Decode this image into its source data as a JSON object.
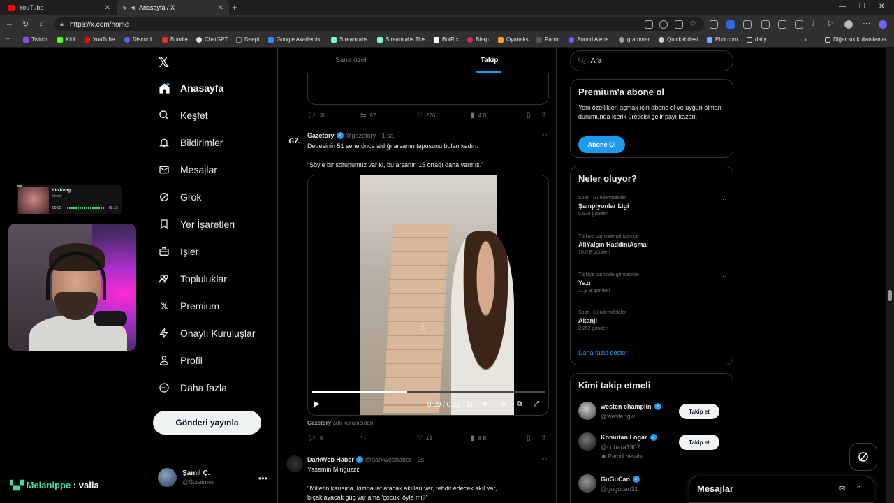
{
  "browser": {
    "tabs": [
      {
        "title": "YouTube",
        "color": "#ff0000"
      },
      {
        "title": "Anasayfa / X",
        "color": "#ffffff"
      }
    ],
    "url": "https://x.com/home",
    "bookmarks": [
      "Twitch",
      "Kick",
      "YouTube",
      "Discord",
      "Bundle",
      "ChatGPT",
      "DeepL",
      "Google Akademik",
      "Streamlabs",
      "Streamlabs Tips",
      "BotRix",
      "Blerp",
      "Oyuneks",
      "Parrot",
      "Sound Alerts",
      "grammer",
      "Quickabdest",
      "Pixlr.com",
      "daily"
    ],
    "bookmarks_other": "Diğer sık kullanılanlar"
  },
  "nav": {
    "items": [
      {
        "label": "Anasayfa",
        "icon": "home-icon"
      },
      {
        "label": "Keşfet",
        "icon": "search-icon"
      },
      {
        "label": "Bildirimler",
        "icon": "bell-icon"
      },
      {
        "label": "Mesajlar",
        "icon": "mail-icon"
      },
      {
        "label": "Grok",
        "icon": "grok-icon"
      },
      {
        "label": "Yer İşaretleri",
        "icon": "bookmark-icon"
      },
      {
        "label": "İşler",
        "icon": "briefcase-icon"
      },
      {
        "label": "Topluluklar",
        "icon": "people-icon"
      },
      {
        "label": "Premium",
        "icon": "x-icon"
      },
      {
        "label": "Onaylı Kuruluşlar",
        "icon": "bolt-icon"
      },
      {
        "label": "Profil",
        "icon": "person-icon"
      },
      {
        "label": "Daha fazla",
        "icon": "more-circle-icon"
      }
    ],
    "post_button": "Gönderi yayınla",
    "user": {
      "name": "Şamil Ç.",
      "handle": "@Scraimm"
    }
  },
  "overlay": {
    "music": {
      "title": "Liu Kong",
      "subtitle": "!moriy",
      "time_start": "00:05",
      "time_end": "02:19"
    },
    "chat": {
      "user": "Melanippe",
      "separator": " : ",
      "message": "valla"
    }
  },
  "timeline": {
    "tabs": [
      "Sana özel",
      "Takip"
    ],
    "prev_actions": {
      "replies": "38",
      "reposts": "97",
      "likes": "276",
      "views": "4 B"
    },
    "tweet1": {
      "avatar_text": "GZ.",
      "name": "Gazetory",
      "handle": "@gazetory",
      "time": "· 1 sa",
      "line1": "Dedesinin 51 sene önce aldığı arsanın tapusunu bulan kadın:",
      "line2": "“Şöyle bir sorunumuz var ki, bu arsanın 15 ortağı daha varmış.”",
      "video_time": "0:09 / 0:22",
      "video_progress": 0.41,
      "via_name": "Gazetory",
      "via_text": "adlı kullanıcıdan",
      "replies": "9",
      "reposts": "",
      "likes": "19",
      "views": "8 B"
    },
    "tweet2": {
      "name": "DarkWeb Haber",
      "handle": "@darkwebhaber",
      "time": "· 2s",
      "line1": "Yasemin Minguzzi:",
      "line2": "\"Milletin karısına, kızına laf atacak akılları var, tehdit edecek akıl var,",
      "line3": "bıçaklayacak güç var ama 'çocuk' öyle mi?\""
    }
  },
  "right": {
    "search_placeholder": "Ara",
    "premium": {
      "title": "Premium'a abone ol",
      "text": "Yeni özellikleri açmak için abone ol ve uygun olman durumunda içerik üreticisi gelir payı kazan.",
      "button": "Abone Ol"
    },
    "trends": {
      "title": "Neler oluyor?",
      "items": [
        {
          "category": "Spor · Gündemdekiler",
          "name": "Şampiyonlar Ligi",
          "count": "5.539 gönderi"
        },
        {
          "category": "Türkiye tarihinde gündemde",
          "name": "AliYalçın HaddiniAşma",
          "count": "10,6 B gönderi"
        },
        {
          "category": "Türkiye tarihinde gündemde",
          "name": "Yazı",
          "count": "11,8 B gönderi"
        },
        {
          "category": "Spor · Gündemdekiler",
          "name": "Akanji",
          "count": "2.262 gönderi"
        }
      ],
      "show_more": "Daha fazla göster"
    },
    "who_to_follow": {
      "title": "Kimi takip etmeli",
      "items": [
        {
          "name": "westen champlin",
          "handle": "@westengw",
          "parody": "",
          "button": "Takip et"
        },
        {
          "name": "Komutan Logar",
          "handle": "@cuhara1907",
          "parody": "Parodi hesabı",
          "button": "Takip et"
        },
        {
          "name": "GuGuCan",
          "handle": "@gugucan31",
          "parody": "",
          "button": ""
        }
      ]
    },
    "messages_title": "Mesajlar"
  }
}
